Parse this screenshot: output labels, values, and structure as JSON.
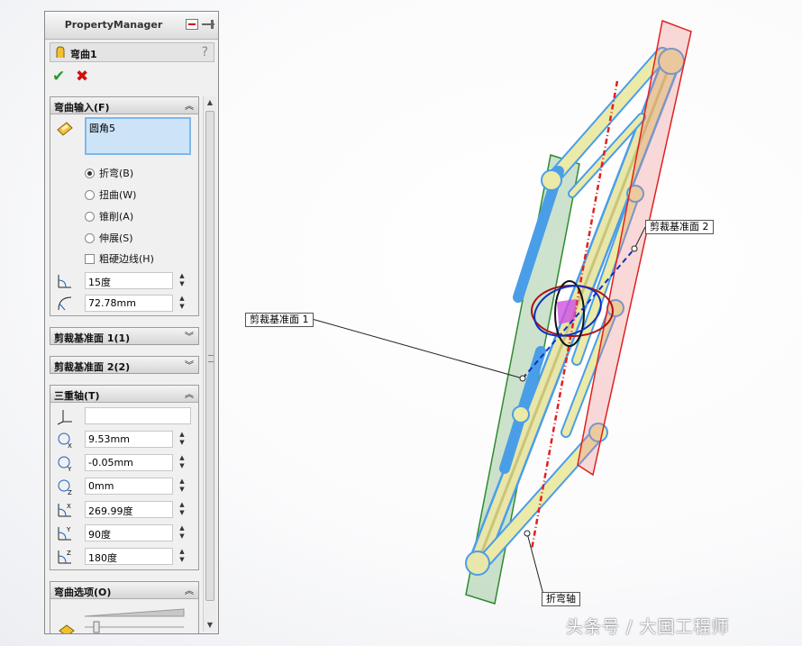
{
  "property_manager": {
    "title": "PropertyManager",
    "feature_name": "弯曲1",
    "help": "?"
  },
  "bend_input": {
    "header": "弯曲输入(F)",
    "selection": "圆角5",
    "options": [
      {
        "label": "折弯(B)",
        "selected": true
      },
      {
        "label": "扭曲(W)",
        "selected": false
      },
      {
        "label": "锥削(A)",
        "selected": false
      },
      {
        "label": "伸展(S)",
        "selected": false
      }
    ],
    "rigid_edges_label": "粗硬边线(H)",
    "angle_value": "15度",
    "radius_value": "72.78mm"
  },
  "trim_plane_1": {
    "header": "剪裁基准面 1(1)"
  },
  "trim_plane_2": {
    "header": "剪裁基准面 2(2)"
  },
  "triad": {
    "header": "三重轴(T)",
    "reference_value": "",
    "x_position": "9.53mm",
    "y_position": "-0.05mm",
    "z_position": "0mm",
    "x_rotation": "269.99度",
    "y_rotation": "90度",
    "z_rotation": "180度"
  },
  "bend_options": {
    "header": "弯曲选项(O)"
  },
  "viewport": {
    "label_trim_plane_1": "剪裁基准面 1",
    "label_trim_plane_2": "剪裁基准面 2",
    "label_bend_axis": "折弯轴",
    "watermark": "头条号 / 大国工程师"
  },
  "icons": [
    "bend-feature-icon",
    "ok-check-icon",
    "cancel-x-icon",
    "pushpin-icon",
    "collapse-chevron-icon",
    "expand-chevron-icon",
    "angle-icon",
    "radius-icon",
    "triad-icon",
    "position-x-icon",
    "position-y-icon",
    "position-z-icon",
    "rotation-x-icon",
    "rotation-y-icon",
    "rotation-z-icon"
  ],
  "colors": {
    "selection_box": "#cde4f8",
    "trim_plane_1": "#2e8b2e",
    "trim_plane_2": "#e02020",
    "part_body": "#e8e6a8",
    "part_edges": "#4a9ee8"
  }
}
